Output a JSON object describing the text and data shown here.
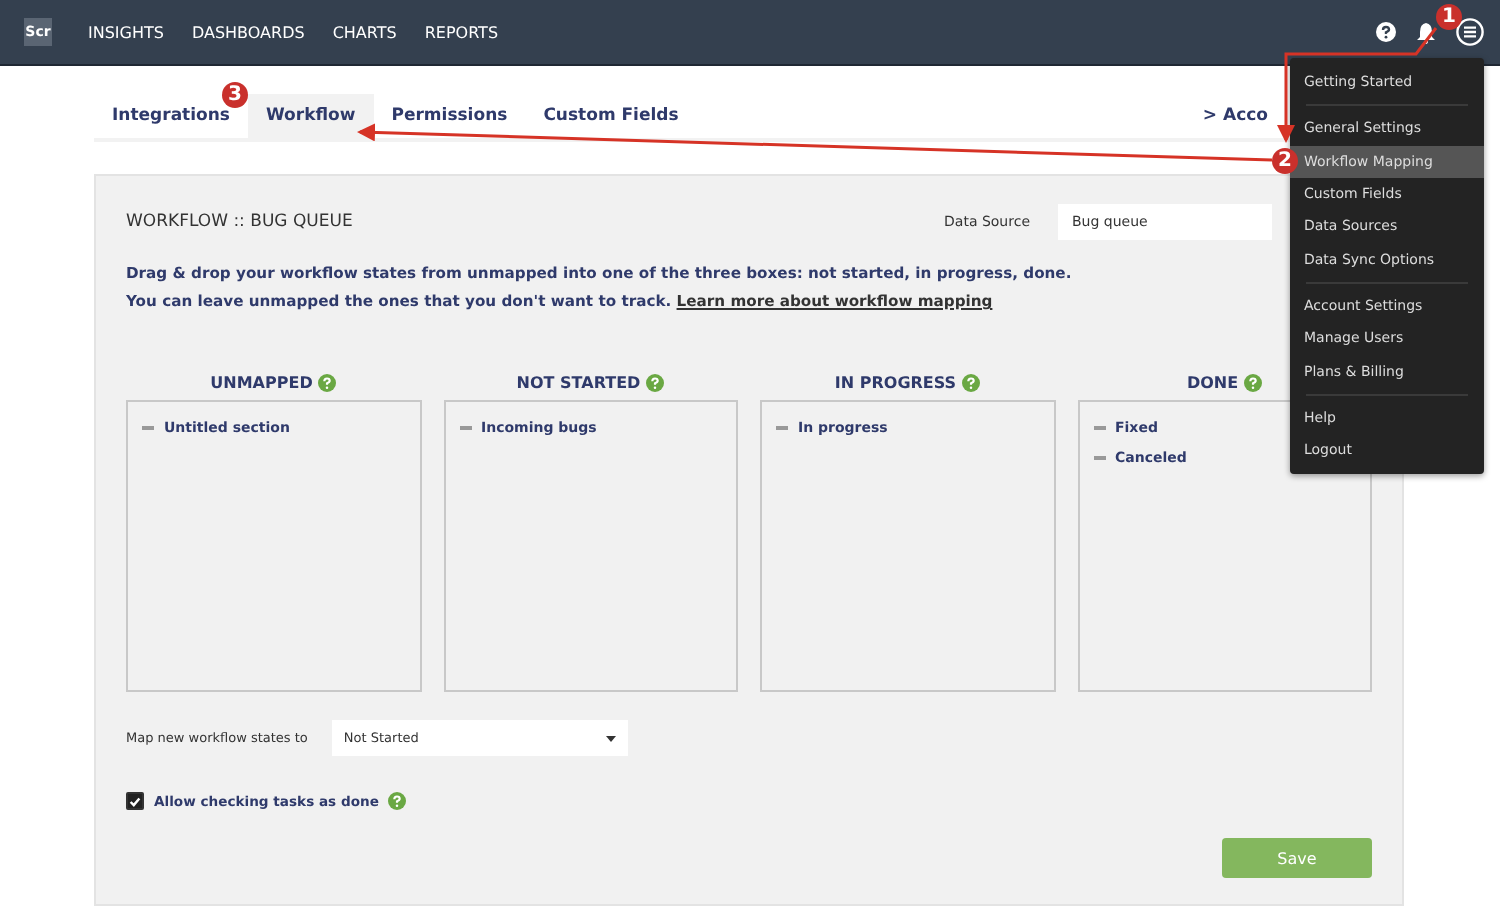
{
  "topbar": {
    "logo": "Scr",
    "nav": [
      "INSIGHTS",
      "DASHBOARDS",
      "CHARTS",
      "REPORTS"
    ]
  },
  "tabs": [
    {
      "label": "Integrations",
      "selected": false
    },
    {
      "label": "Workflow",
      "selected": true
    },
    {
      "label": "Permissions",
      "selected": false
    },
    {
      "label": "Custom Fields",
      "selected": false
    }
  ],
  "account_link": "> Acco",
  "panel": {
    "title": "WORKFLOW :: BUG QUEUE",
    "data_source_label": "Data Source",
    "data_source_value": "Bug queue",
    "intro": "Drag & drop your workflow states from unmapped into one of the three boxes: not started, in progress, done.",
    "intro2": "You can leave unmapped the ones that you don't want to track.",
    "learn_more": "Learn more about workflow mapping",
    "columns": [
      {
        "title": "UNMAPPED",
        "items": [
          "Untitled section"
        ]
      },
      {
        "title": "NOT STARTED",
        "items": [
          "Incoming bugs"
        ]
      },
      {
        "title": "IN PROGRESS",
        "items": [
          "In progress"
        ]
      },
      {
        "title": "DONE",
        "items": [
          "Fixed",
          "Canceled"
        ]
      }
    ],
    "map_label": "Map new workflow states to",
    "map_value": "Not Started",
    "allow_done": {
      "label": "Allow checking tasks as done",
      "checked": true
    },
    "save": "Save"
  },
  "menu": {
    "groups": [
      [
        {
          "label": "Getting Started",
          "selected": false
        }
      ],
      [
        {
          "label": "General Settings",
          "selected": false
        },
        {
          "label": "Workflow Mapping",
          "selected": true
        },
        {
          "label": "Custom Fields",
          "selected": false
        },
        {
          "label": "Data Sources",
          "selected": false
        },
        {
          "label": "Data Sync Options",
          "selected": false
        }
      ],
      [
        {
          "label": "Account Settings",
          "selected": false
        },
        {
          "label": "Manage Users",
          "selected": false
        },
        {
          "label": "Plans & Billing",
          "selected": false
        }
      ],
      [
        {
          "label": "Help",
          "selected": false
        },
        {
          "label": "Logout",
          "selected": false
        }
      ]
    ]
  },
  "annotations": [
    "1",
    "2",
    "3"
  ]
}
